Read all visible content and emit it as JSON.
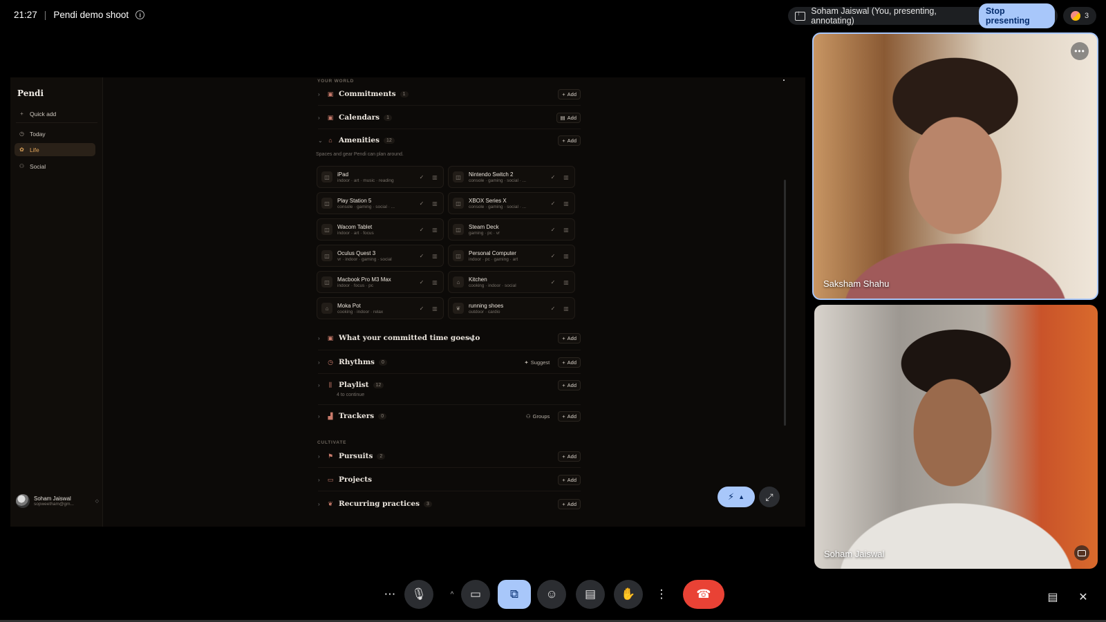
{
  "meeting": {
    "time": "21:27",
    "separator": "|",
    "title": "Pendi demo shoot",
    "presenter_label": "Soham Jaiswal (You, presenting, annotating)",
    "stop_label": "Stop presenting",
    "participants_count": "3"
  },
  "app": {
    "brand": "Pendi",
    "nav": [
      {
        "label": "Quick add",
        "icon": "plus-icon"
      },
      {
        "label": "Today",
        "icon": "clock-icon"
      },
      {
        "label": "Life",
        "icon": "sprout-icon",
        "active": true
      },
      {
        "label": "Social",
        "icon": "people-icon"
      }
    ],
    "user": {
      "name": "Soham Jaiswal",
      "email": "sopweetham@gm..."
    },
    "your_world_label": "YOUR WORLD",
    "cultivate_label": "CULTIVATE",
    "sections": {
      "commitments": {
        "title": "Commitments",
        "count": "1",
        "add": "Add"
      },
      "calendars": {
        "title": "Calendars",
        "count": "1",
        "add": "Add"
      },
      "amenities": {
        "title": "Amenities",
        "count": "12",
        "add": "Add",
        "subtitle": "Spaces and gear Pendi can plan around."
      },
      "committed_time": {
        "title": "What your committed time goes to",
        "add": "Add"
      },
      "rhythms": {
        "title": "Rhythms",
        "count": "0",
        "extra": "Suggest",
        "add": "Add"
      },
      "playlist": {
        "title": "Playlist",
        "count": "12",
        "subtitle": "4 to continue",
        "add": "Add"
      },
      "trackers": {
        "title": "Trackers",
        "count": "0",
        "extra": "Groups",
        "add": "Add"
      },
      "pursuits": {
        "title": "Pursuits",
        "count": "2",
        "add": "Add"
      },
      "projects": {
        "title": "Projects",
        "add": "Add"
      },
      "recurring": {
        "title": "Recurring practices",
        "count": "3",
        "add": "Add"
      }
    },
    "amenities": [
      {
        "name": "iPad",
        "tags": "indoor · art · music · reading",
        "icon": "gamepad-icon"
      },
      {
        "name": "Nintendo Switch 2",
        "tags": "console · gaming · social · ...",
        "icon": "gamepad-icon"
      },
      {
        "name": "Play Station 5",
        "tags": "console · gaming · social · ...",
        "icon": "gamepad-icon"
      },
      {
        "name": "XBOX Series X",
        "tags": "console · gaming · social · ...",
        "icon": "gamepad-icon"
      },
      {
        "name": "Wacom Tablet",
        "tags": "indoor · art · focus",
        "icon": "gamepad-icon"
      },
      {
        "name": "Steam Deck",
        "tags": "gaming · pc · vr",
        "icon": "gamepad-icon"
      },
      {
        "name": "Oculus Quest 3",
        "tags": "vr · indoor · gaming · social",
        "icon": "gamepad-icon"
      },
      {
        "name": "Personal Computer",
        "tags": "indoor · pc · gaming · art",
        "icon": "gamepad-icon"
      },
      {
        "name": "Macbook Pro M3 Max",
        "tags": "indoor · focus · pc",
        "icon": "gamepad-icon"
      },
      {
        "name": "Kitchen",
        "tags": "cooking · indoor · social",
        "icon": "home-icon"
      },
      {
        "name": "Moka Pot",
        "tags": "cooking · indoor · relax",
        "icon": "home-icon"
      },
      {
        "name": "running shoes",
        "tags": "outdoor · cardio",
        "icon": "leaf-icon"
      }
    ]
  },
  "tiles": [
    {
      "name": "Saksham Shahu"
    },
    {
      "name": "Soham Jaiswal"
    }
  ],
  "colors": {
    "accent": "#a8c7fa",
    "end_call": "#e94235",
    "life_active": "#e0a55a"
  }
}
